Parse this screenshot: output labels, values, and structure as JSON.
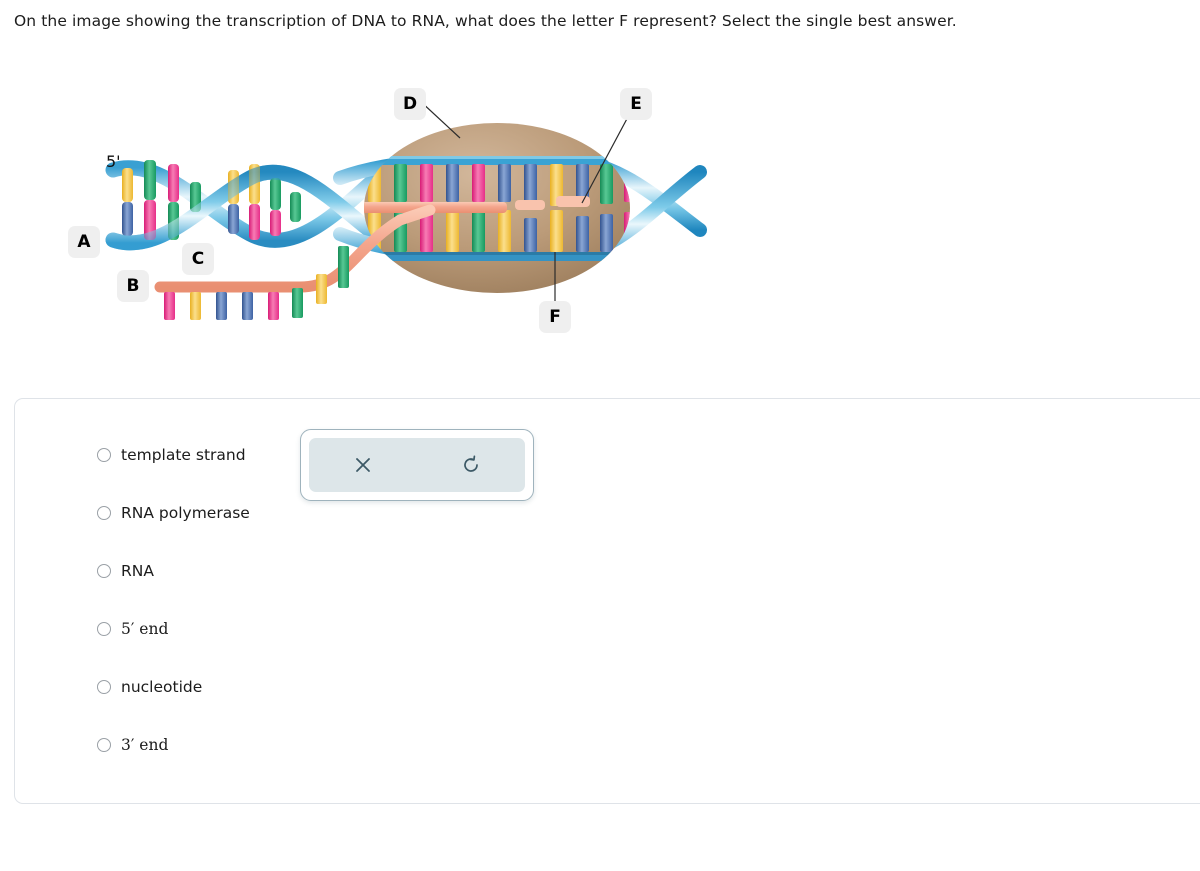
{
  "question": {
    "prompt": "On the image showing the transcription of DNA to RNA, what does the letter F represent? Select the single best answer."
  },
  "figure": {
    "alt_title": "Transcription of DNA to RNA diagram",
    "end_marker": "5'",
    "labels": [
      {
        "id": "A",
        "letter": "A",
        "target": "left DNA double helix"
      },
      {
        "id": "B",
        "letter": "B",
        "target": "RNA transcript bases"
      },
      {
        "id": "C",
        "letter": "C",
        "target": "RNA backbone"
      },
      {
        "id": "D",
        "letter": "D",
        "target": "RNA polymerase enzyme"
      },
      {
        "id": "E",
        "letter": "E",
        "target": "incoming nucleotide"
      },
      {
        "id": "F",
        "letter": "F",
        "target": "template DNA strand"
      }
    ],
    "colors": {
      "dna_backbone": "#2f9bd0",
      "dna_backbone_light": "#d9eef8",
      "polymerase": "#b49070",
      "rna_backbone": "#f4a58c",
      "base_yellow": "#f5c842",
      "base_green": "#21a66b",
      "base_pink": "#ec4899",
      "base_blue": "#4a6fb5",
      "badge_bg": "#efefef",
      "leader_line": "#333333"
    }
  },
  "answers": {
    "options": [
      {
        "text": "template strand",
        "selected": false,
        "style": "plain"
      },
      {
        "text": "RNA polymerase",
        "selected": false,
        "style": "plain"
      },
      {
        "text": "RNA",
        "selected": false,
        "style": "plain"
      },
      {
        "text": "5′ end",
        "selected": false,
        "style": "prime"
      },
      {
        "text": "nucleotide",
        "selected": false,
        "style": "plain"
      },
      {
        "text": "3′ end",
        "selected": false,
        "style": "prime"
      }
    ]
  },
  "toolbar": {
    "close_label": "✕",
    "reset_label": "↺",
    "buttons": [
      {
        "name": "close",
        "icon": "close-icon"
      },
      {
        "name": "reset",
        "icon": "refresh-ccw-icon"
      }
    ],
    "colors": {
      "panel": "#dde6e9",
      "border": "#9fb3bd",
      "icon": "#3c5966"
    }
  }
}
